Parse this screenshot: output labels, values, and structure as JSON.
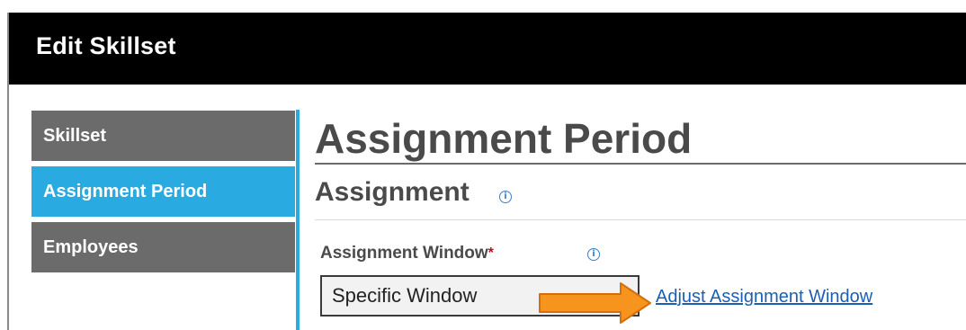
{
  "window": {
    "title": "Edit Skillset"
  },
  "sidebar": {
    "items": [
      {
        "label": "Skillset",
        "active": false
      },
      {
        "label": "Assignment Period",
        "active": true
      },
      {
        "label": "Employees",
        "active": false
      }
    ],
    "active_color": "#29abe2",
    "inactive_color": "#6b6b6b"
  },
  "main": {
    "page_title": "Assignment Period",
    "section_title": "Assignment",
    "field": {
      "label": "Assignment Window",
      "required_marker": "*",
      "value": "Specific Window",
      "link_text": "Adjust Assignment Window"
    }
  },
  "annotation": {
    "arrow_color": "#f7941d",
    "arrow_direction": "right"
  },
  "icons": {
    "info_glyph": "i"
  }
}
